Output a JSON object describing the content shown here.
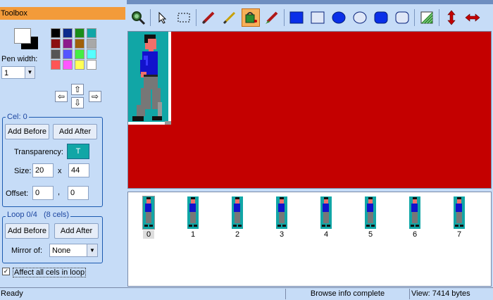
{
  "toolbox": {
    "title": "Toolbox",
    "pen_width_label": "Pen width:",
    "pen_width_value": "1",
    "palette": [
      "#000000",
      "#0b2a8c",
      "#1a8c1a",
      "#11a6a6",
      "#8c1010",
      "#8c1a8c",
      "#a0600a",
      "#a8a8a8",
      "#555555",
      "#5555ff",
      "#44ee44",
      "#55ffff",
      "#ff5555",
      "#ff55ff",
      "#ffff55",
      "#ffffff"
    ],
    "cel": {
      "title": "Cel: 0",
      "add_before": "Add Before",
      "add_after": "Add After",
      "transparency_label": "Transparency:",
      "transparency_value": "T",
      "size_label": "Size:",
      "width": "20",
      "x_label": "x",
      "height": "44",
      "offset_label": "Offset:",
      "offset_x": "0",
      "comma": ",",
      "offset_y": "0"
    },
    "loop": {
      "title": "Loop 0/4",
      "count": "(8 cels)",
      "add_before": "Add Before",
      "add_after": "Add After",
      "mirror_label": "Mirror of:",
      "mirror_value": "None"
    },
    "affect_all_label": "Affect all cels in loop",
    "affect_all_checked": true
  },
  "cels": [
    "0",
    "1",
    "2",
    "3",
    "4",
    "5",
    "6",
    "7"
  ],
  "status": {
    "left": "Ready",
    "middle": "Browse info complete",
    "right": "View: 7414 bytes"
  }
}
